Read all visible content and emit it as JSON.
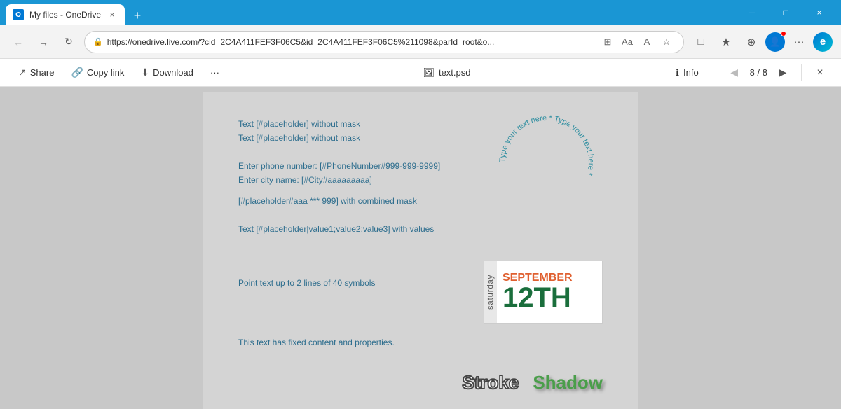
{
  "browser": {
    "tab": {
      "favicon_text": "O",
      "title": "My files - OneDrive",
      "close_label": "×"
    },
    "new_tab_label": "+",
    "controls": {
      "minimize": "─",
      "maximize": "□",
      "close": "×"
    },
    "nav": {
      "back_label": "←",
      "forward_label": "→",
      "refresh_label": "↻"
    },
    "address": {
      "url": "https://onedrive.live.com/?cid=2C4A411FEF3F06C5&id=2C4A411FEF3F06C5%211098&parId=root&o...",
      "lock_icon": "🔒"
    },
    "toolbar_icons": [
      "⊞",
      "Aa",
      "A",
      "☆",
      "□",
      "★",
      "⊕",
      "⋯"
    ],
    "edge_label": "e"
  },
  "file_toolbar": {
    "share_label": "Share",
    "copy_link_label": "Copy link",
    "download_label": "Download",
    "more_label": "···",
    "file_name": "text.psd",
    "info_label": "Info",
    "page_current": "8",
    "page_total": "8",
    "close_label": "×"
  },
  "canvas": {
    "lines": {
      "line1": "Text [#placeholder] without mask",
      "line2": "Text [#placeholder] without mask",
      "phone": "Enter phone number: [#PhoneNumber#999-999-9999]",
      "city": "Enter city name: [#City#aaaaaaaaa]",
      "combined": "[#placeholder#aaa *** 999] with combined mask",
      "values": "Text [#placeholder|value1;value2;value3] with values",
      "point": "Point text up to 2 lines of 40 symbols",
      "fixed": "This text has fixed content and properties."
    },
    "circular": {
      "text": "Type your text here * Type your text here *"
    },
    "date": {
      "day_of_week": "saturday",
      "month": "SEPTEMBER",
      "date": "12TH"
    },
    "stroke_text": "Stroke",
    "shadow_text": "Shadow"
  }
}
